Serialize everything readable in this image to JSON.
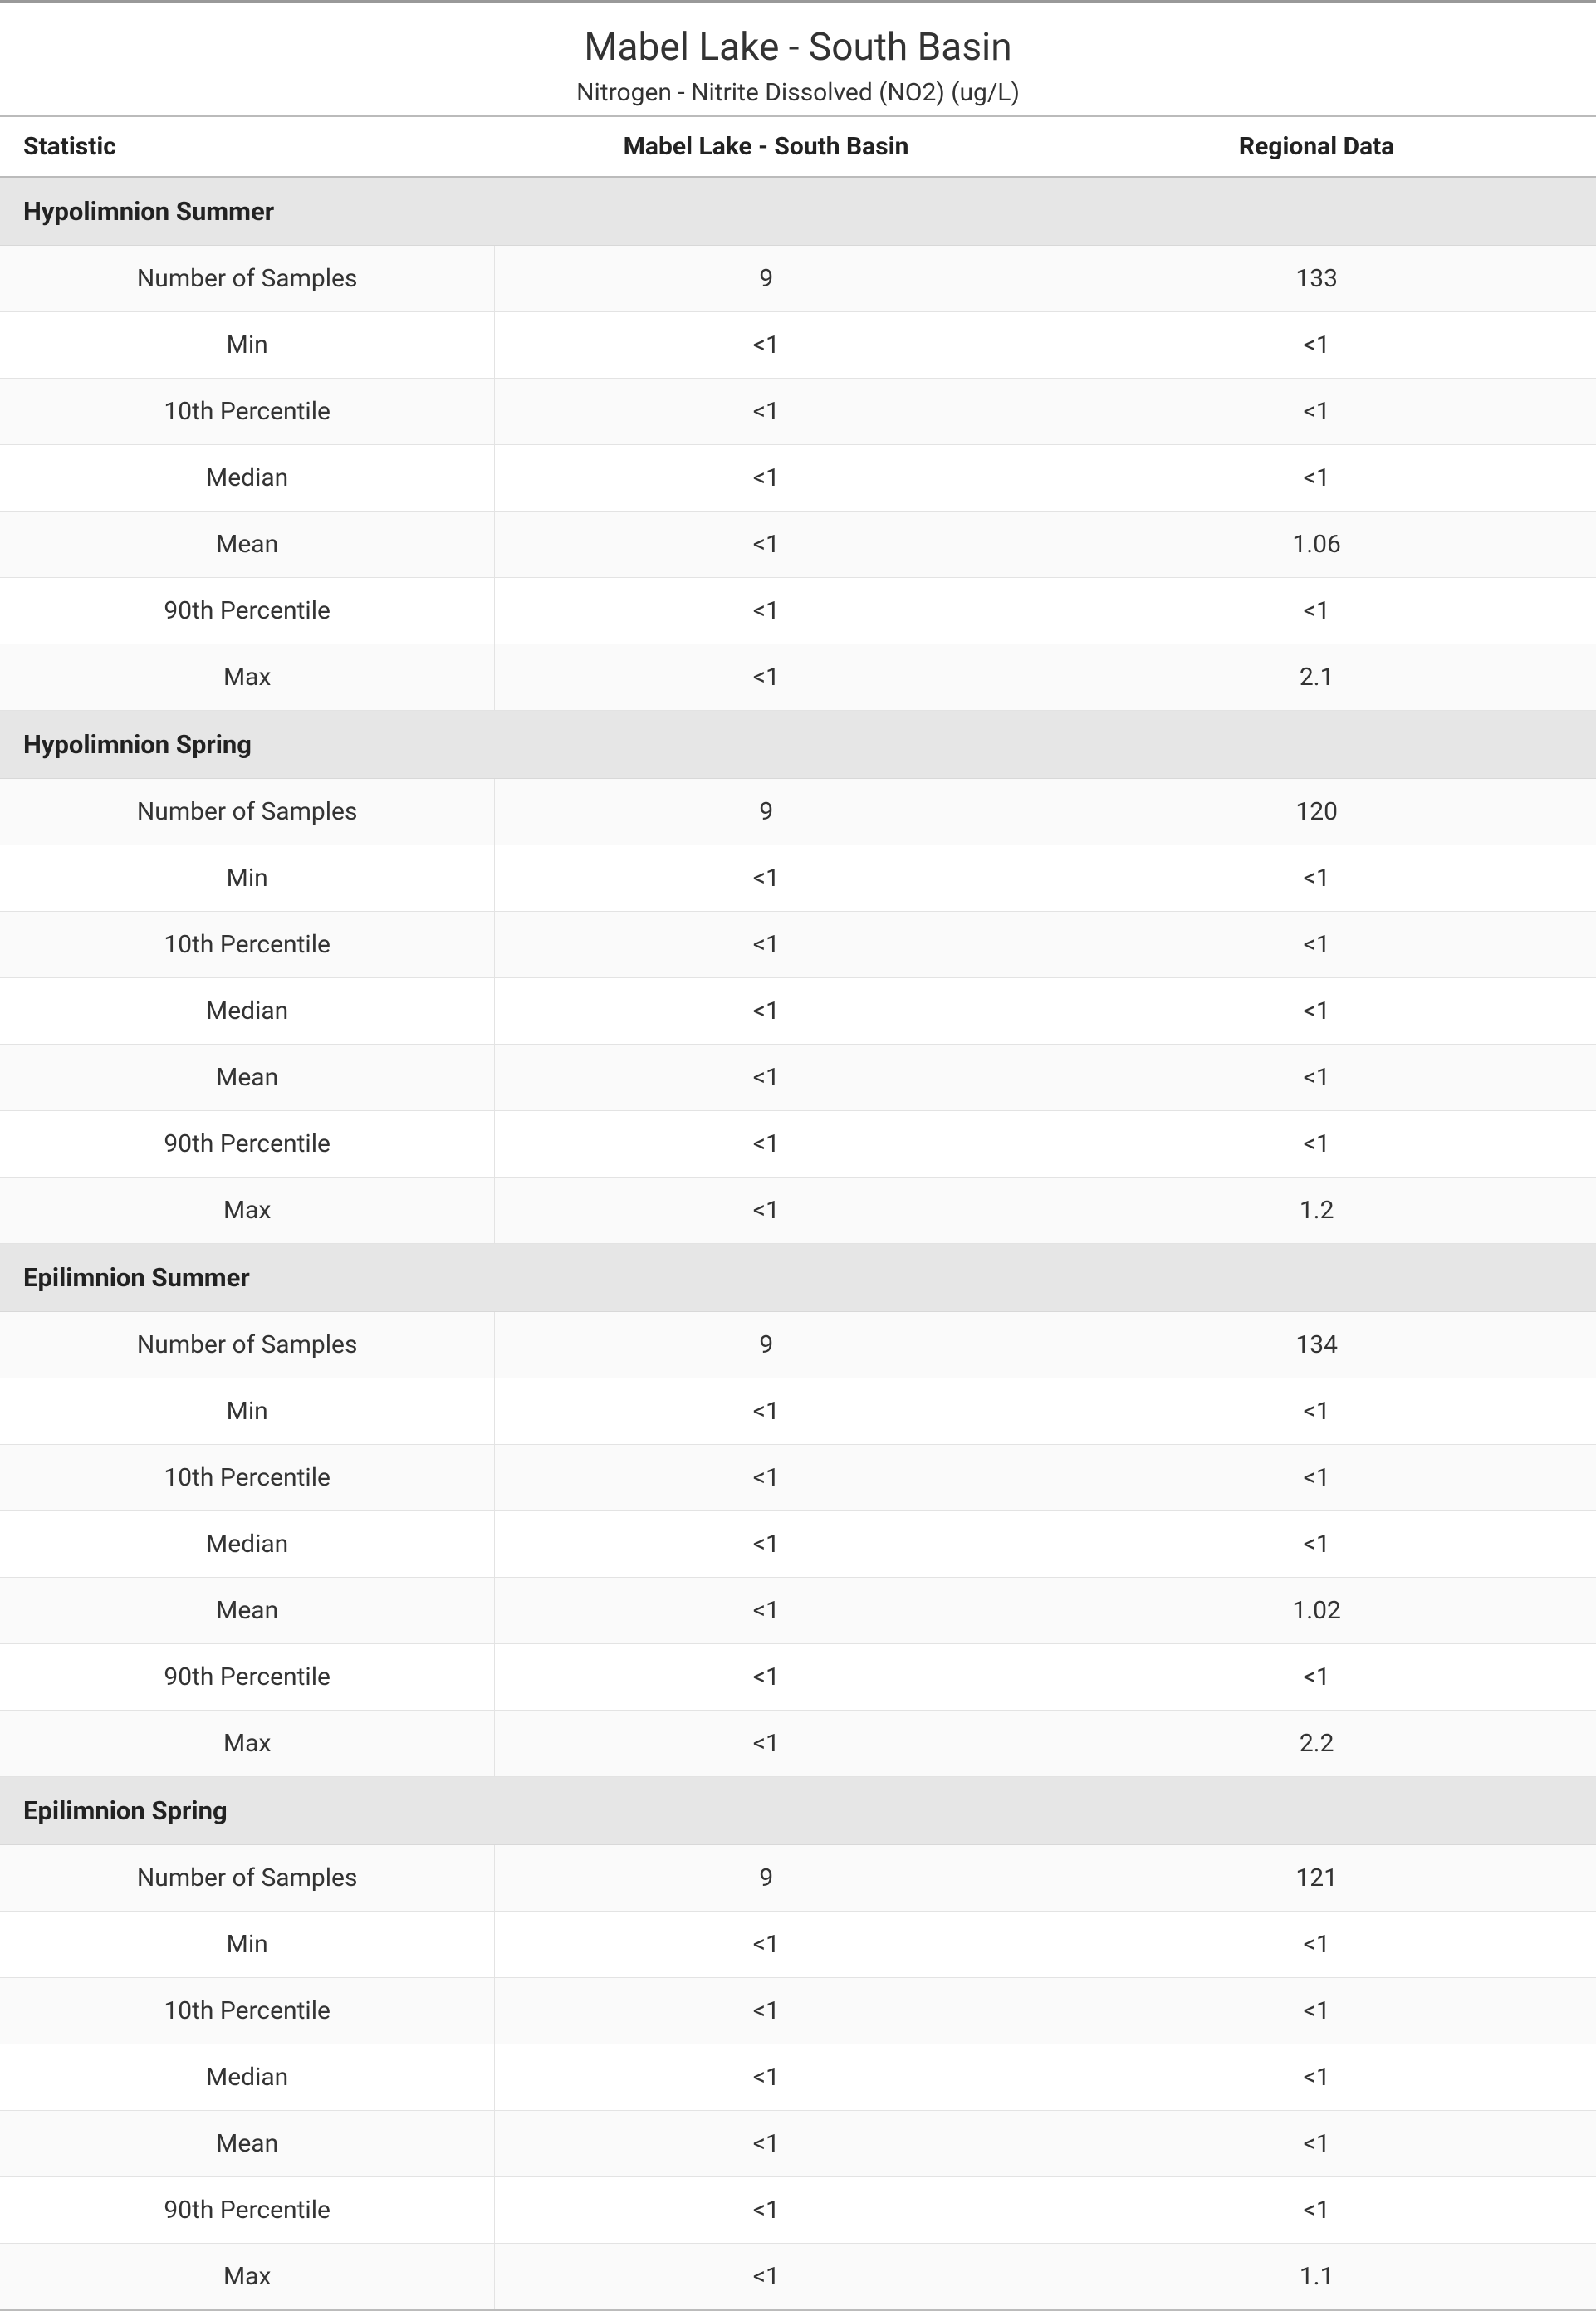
{
  "title": "Mabel Lake - South Basin",
  "subtitle": "Nitrogen - Nitrite Dissolved (NO2) (ug/L)",
  "columns": {
    "stat": "Statistic",
    "lake": "Mabel Lake - South Basin",
    "regional": "Regional Data"
  },
  "stat_labels": {
    "n": "Number of Samples",
    "min": "Min",
    "p10": "10th Percentile",
    "median": "Median",
    "mean": "Mean",
    "p90": "90th Percentile",
    "max": "Max"
  },
  "groups": [
    {
      "name": "Hypolimnion Summer",
      "rows": {
        "n": {
          "lake": "9",
          "regional": "133"
        },
        "min": {
          "lake": "<1",
          "regional": "<1"
        },
        "p10": {
          "lake": "<1",
          "regional": "<1"
        },
        "median": {
          "lake": "<1",
          "regional": "<1"
        },
        "mean": {
          "lake": "<1",
          "regional": "1.06"
        },
        "p90": {
          "lake": "<1",
          "regional": "<1"
        },
        "max": {
          "lake": "<1",
          "regional": "2.1"
        }
      }
    },
    {
      "name": "Hypolimnion Spring",
      "rows": {
        "n": {
          "lake": "9",
          "regional": "120"
        },
        "min": {
          "lake": "<1",
          "regional": "<1"
        },
        "p10": {
          "lake": "<1",
          "regional": "<1"
        },
        "median": {
          "lake": "<1",
          "regional": "<1"
        },
        "mean": {
          "lake": "<1",
          "regional": "<1"
        },
        "p90": {
          "lake": "<1",
          "regional": "<1"
        },
        "max": {
          "lake": "<1",
          "regional": "1.2"
        }
      }
    },
    {
      "name": "Epilimnion Summer",
      "rows": {
        "n": {
          "lake": "9",
          "regional": "134"
        },
        "min": {
          "lake": "<1",
          "regional": "<1"
        },
        "p10": {
          "lake": "<1",
          "regional": "<1"
        },
        "median": {
          "lake": "<1",
          "regional": "<1"
        },
        "mean": {
          "lake": "<1",
          "regional": "1.02"
        },
        "p90": {
          "lake": "<1",
          "regional": "<1"
        },
        "max": {
          "lake": "<1",
          "regional": "2.2"
        }
      }
    },
    {
      "name": "Epilimnion Spring",
      "rows": {
        "n": {
          "lake": "9",
          "regional": "121"
        },
        "min": {
          "lake": "<1",
          "regional": "<1"
        },
        "p10": {
          "lake": "<1",
          "regional": "<1"
        },
        "median": {
          "lake": "<1",
          "regional": "<1"
        },
        "mean": {
          "lake": "<1",
          "regional": "<1"
        },
        "p90": {
          "lake": "<1",
          "regional": "<1"
        },
        "max": {
          "lake": "<1",
          "regional": "1.1"
        }
      }
    }
  ]
}
